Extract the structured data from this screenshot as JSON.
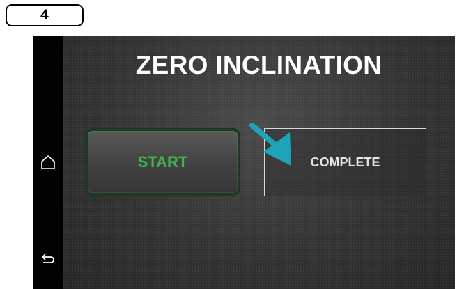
{
  "step": {
    "number": "4"
  },
  "screen": {
    "title": "ZERO INCLINATION",
    "start_label": "START",
    "complete_label": "COMPLETE"
  },
  "nav": {
    "home_icon": "home-outline-icon",
    "back_icon": "back-arrow-icon"
  },
  "annotation": {
    "arrow_icon": "pointer-arrow-icon",
    "arrow_color": "#1fa3b8"
  },
  "colors": {
    "start_text": "#3fb34a",
    "start_border": "#1c3a22",
    "complete_border": "#d8d8d8",
    "screen_background": "#2e2e2e"
  }
}
